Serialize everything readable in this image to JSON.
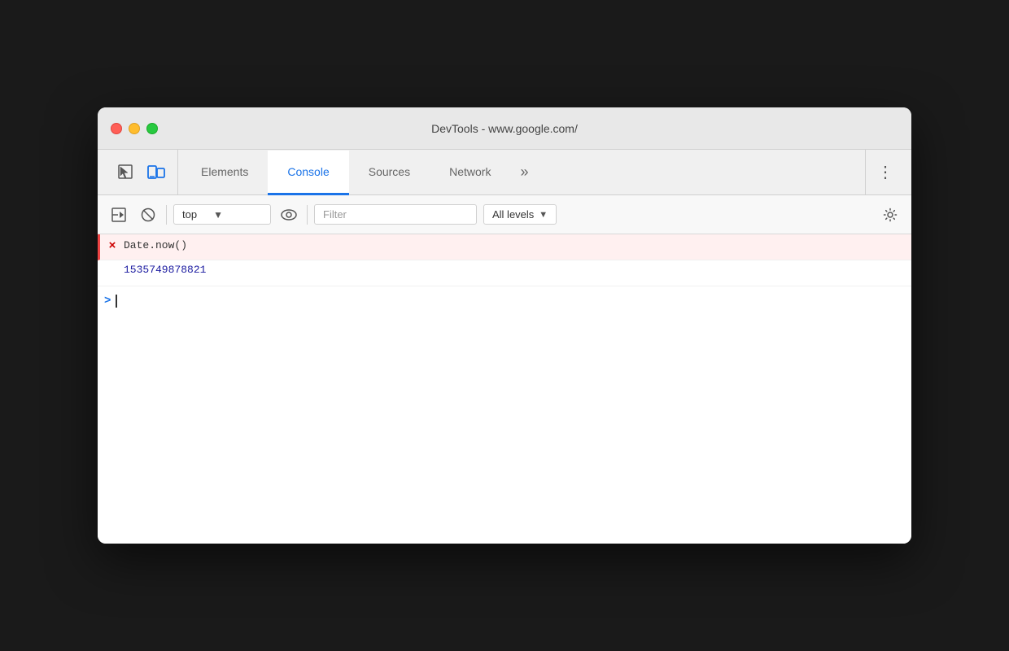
{
  "window": {
    "title": "DevTools - www.google.com/"
  },
  "traffic_lights": {
    "close_label": "close",
    "minimize_label": "minimize",
    "maximize_label": "maximize"
  },
  "tabs": {
    "items": [
      {
        "id": "elements",
        "label": "Elements",
        "active": false
      },
      {
        "id": "console",
        "label": "Console",
        "active": true
      },
      {
        "id": "sources",
        "label": "Sources",
        "active": false
      },
      {
        "id": "network",
        "label": "Network",
        "active": false
      }
    ],
    "more_label": "»",
    "menu_label": "⋮"
  },
  "toolbar": {
    "sidebar_icon": "▶",
    "clear_icon": "🚫",
    "context_value": "top",
    "context_placeholder": "top",
    "eye_icon": "👁",
    "filter_placeholder": "Filter",
    "levels_label": "All levels",
    "settings_icon": "⚙"
  },
  "console": {
    "entries": [
      {
        "type": "error_input",
        "icon": "×",
        "text": "Date.now()"
      },
      {
        "type": "result",
        "value": "1535749878821"
      }
    ],
    "prompt": ">"
  }
}
